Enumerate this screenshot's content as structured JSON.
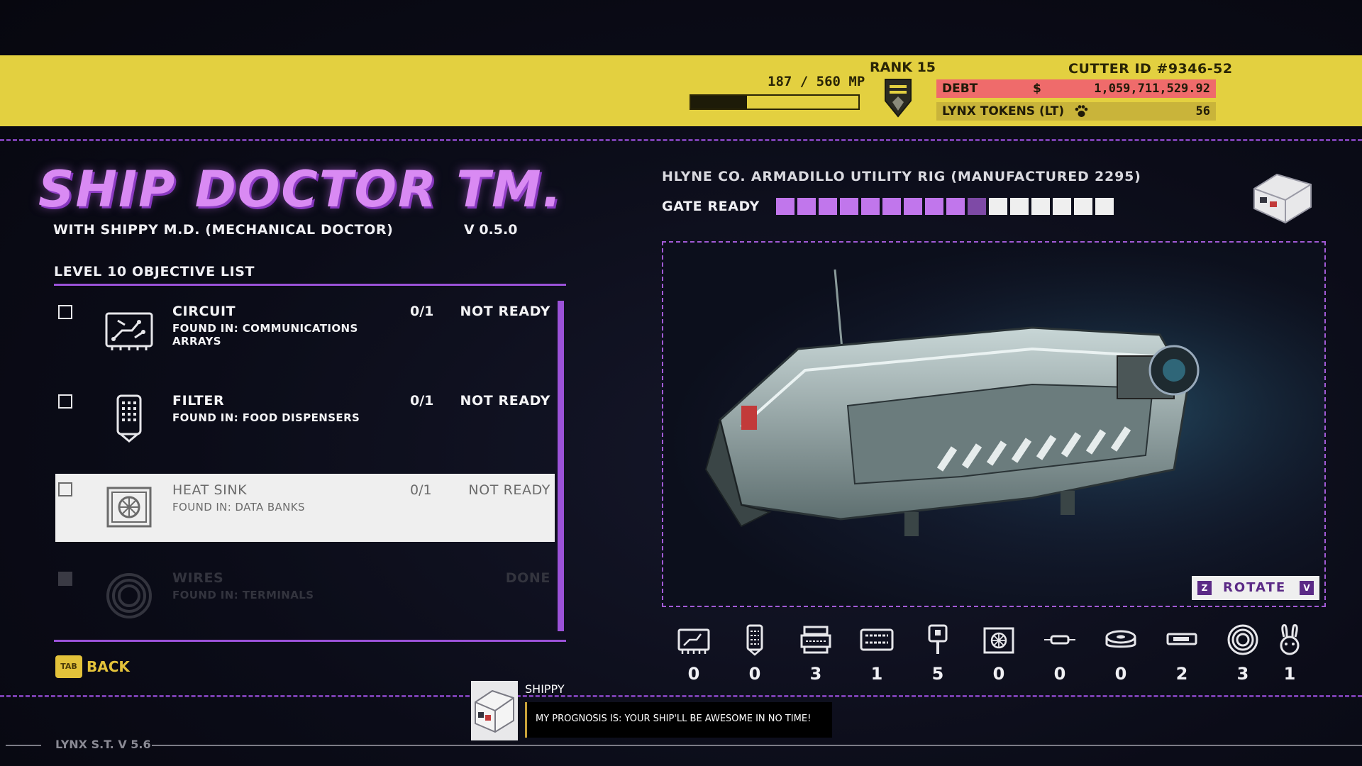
{
  "header": {
    "mp_text": "187 / 560 MP",
    "mp_progress": 0.334,
    "rank": "RANK 15",
    "cutter_id": "CUTTER ID  #9346-52",
    "debt_label": "DEBT",
    "debt_symbol": "$",
    "debt_value": "1,059,711,529.92",
    "tokens_label": "LYNX TOKENS (LT)",
    "tokens_value": "56"
  },
  "title": {
    "main": "SHIP DOCTOR TM.",
    "subtitle": "WITH SHIPPY M.D. (MECHANICAL DOCTOR)",
    "version": "V 0.5.0"
  },
  "objectives": {
    "heading": "LEVEL 10 OBJECTIVE LIST",
    "items": [
      {
        "name": "CIRCUIT",
        "found": "FOUND IN: COMMUNICATIONS ARRAYS",
        "count": "0/1",
        "status": "NOT READY",
        "icon": "circuit-icon"
      },
      {
        "name": "FILTER",
        "found": "FOUND IN: FOOD DISPENSERS",
        "count": "0/1",
        "status": "NOT READY",
        "icon": "filter-icon"
      },
      {
        "name": "HEAT SINK",
        "found": "FOUND IN: DATA BANKS",
        "count": "0/1",
        "status": "NOT READY",
        "icon": "heat-sink-icon"
      },
      {
        "name": "WIRES",
        "found": "FOUND IN: TERMINALS",
        "count": "",
        "status": "DONE",
        "icon": "wires-icon"
      }
    ],
    "back_key": "TAB",
    "back_label": "BACK"
  },
  "ship": {
    "title": "HLYNE CO. ARMADILLO UTILITY RIG (MANUFACTURED 2295)",
    "gate_label": "GATE READY",
    "gate_filled": 9,
    "gate_partial": 1,
    "gate_total": 16,
    "rotate_left_key": "Z",
    "rotate_label": "ROTATE",
    "rotate_right_key": "V"
  },
  "inventory": [
    {
      "icon": "circuit-icon",
      "count": "0"
    },
    {
      "icon": "filter-icon",
      "count": "0"
    },
    {
      "icon": "connector-icon",
      "count": "3"
    },
    {
      "icon": "memory-icon",
      "count": "1"
    },
    {
      "icon": "valve-icon",
      "count": "5"
    },
    {
      "icon": "heat-sink-icon",
      "count": "0"
    },
    {
      "icon": "fuse-icon",
      "count": "0"
    },
    {
      "icon": "tape-icon",
      "count": "0"
    },
    {
      "icon": "battery-icon",
      "count": "2"
    },
    {
      "icon": "wires-icon",
      "count": "3"
    },
    {
      "icon": "bunny-icon",
      "count": "1"
    }
  ],
  "dialog": {
    "speaker": "SHIPPY",
    "text": "MY PROGNOSIS IS: YOUR SHIP'LL BE AWESOME IN NO TIME!"
  },
  "footer": {
    "version": "LYNX S.T. V 5.6"
  },
  "colors": {
    "accent_purple": "#c176ec",
    "bar_yellow": "#e3d040",
    "debt_red": "#ef6b6b"
  }
}
